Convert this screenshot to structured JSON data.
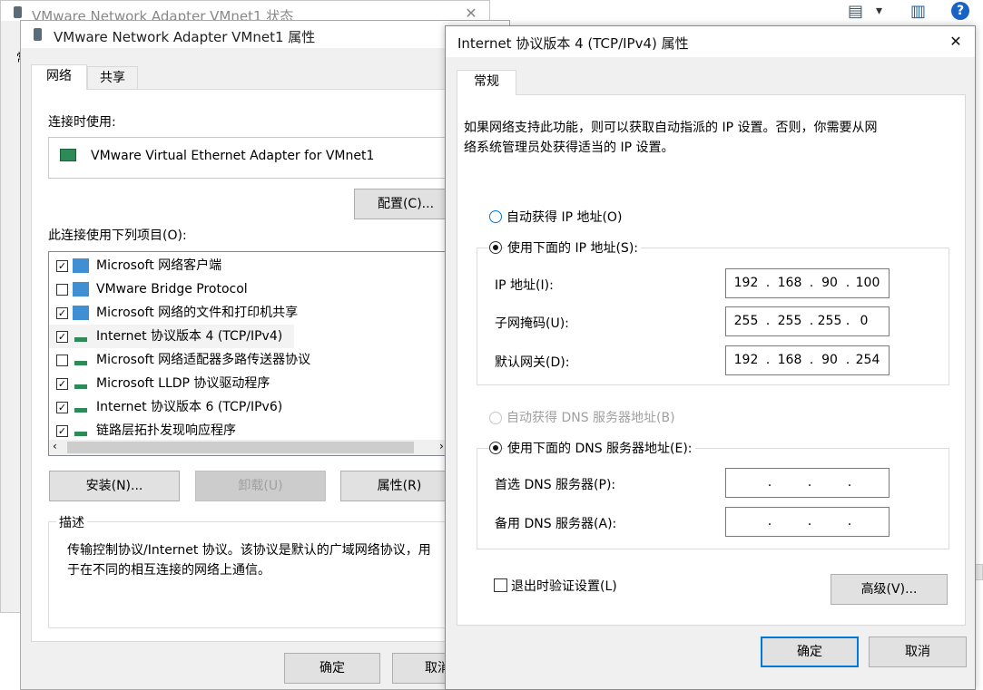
{
  "bg_window": {
    "title": "VMware Network Adapter VMnet1 状态",
    "partial_char": "常"
  },
  "top_icons": {
    "view": "▤",
    "dropdown": "▾",
    "pane": "▥",
    "help": "?"
  },
  "adapter_dialog": {
    "title": "VMware Network Adapter VMnet1 属性",
    "tabs": [
      "网络",
      "共享"
    ],
    "connect_using_label": "连接时使用:",
    "adapter_name": "VMware Virtual Ethernet Adapter for VMnet1",
    "configure_button": "配置(C)...",
    "items_label": "此连接使用下列项目(O):",
    "items": [
      {
        "label": "Microsoft 网络客户端",
        "checked": true
      },
      {
        "label": "VMware Bridge Protocol",
        "checked": false
      },
      {
        "label": "Microsoft 网络的文件和打印机共享",
        "checked": true
      },
      {
        "label": "Internet 协议版本 4 (TCP/IPv4)",
        "checked": true
      },
      {
        "label": "Microsoft 网络适配器多路传送器协议",
        "checked": false
      },
      {
        "label": "Microsoft LLDP 协议驱动程序",
        "checked": true
      },
      {
        "label": "Internet 协议版本 6 (TCP/IPv6)",
        "checked": true
      },
      {
        "label": "链路层拓扑发现响应程序",
        "checked": true
      }
    ],
    "install_button": "安装(N)...",
    "uninstall_button": "卸载(U)",
    "properties_button": "属性(R)",
    "description_label": "描述",
    "description_text_line1": "传输控制协议/Internet 协议。该协议是默认的广域网络协议，用",
    "description_text_line2": "于在不同的相互连接的网络上通信。",
    "ok_button": "确定",
    "cancel_button": "取消"
  },
  "ipv4_dialog": {
    "title": "Internet 协议版本 4 (TCP/IPv4) 属性",
    "close_glyph": "✕",
    "tab": "常规",
    "intro_line1": "如果网络支持此功能，则可以获取自动指派的 IP 设置。否则，你需要从网",
    "intro_line2": "络系统管理员处获得适当的 IP 设置。",
    "auto_ip_label": "自动获得 IP 地址(O)",
    "manual_ip_label": "使用下面的 IP 地址(S):",
    "ip_label": "IP 地址(I):",
    "ip_value": [
      "192",
      "168",
      "90",
      "100"
    ],
    "subnet_label": "子网掩码(U):",
    "subnet_value": [
      "255",
      "255",
      "255",
      "0"
    ],
    "gateway_label": "默认网关(D):",
    "gateway_value": [
      "192",
      "168",
      "90",
      "254"
    ],
    "auto_dns_label": "自动获得 DNS 服务器地址(B)",
    "manual_dns_label": "使用下面的 DNS 服务器地址(E):",
    "pref_dns_label": "首选 DNS 服务器(P):",
    "alt_dns_label": "备用 DNS 服务器(A):",
    "validate_label": "退出时验证设置(L)",
    "advanced_button": "高级(V)...",
    "ok_button": "确定",
    "cancel_button": "取消"
  }
}
